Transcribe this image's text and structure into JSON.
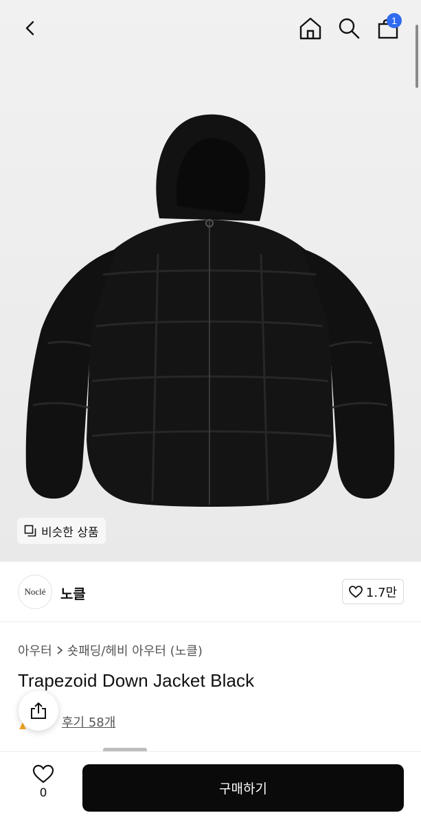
{
  "nav": {
    "back_icon": "chevron-left-icon",
    "home_icon": "home-icon",
    "search_icon": "search-icon",
    "cart_icon": "shopping-bag-icon",
    "cart_badge": "1",
    "badge_color": "#2f6bf0"
  },
  "hero": {
    "similar_label": "비슷한 상품",
    "similar_icon": "copy-icon"
  },
  "brand": {
    "logo_text": "Noclé",
    "name": "노클",
    "like_icon": "heart-icon",
    "like_count": "1.7만"
  },
  "breadcrumb": {
    "items": [
      "아우터",
      "숏패딩/헤비 아우터 (노클)"
    ]
  },
  "product": {
    "title": "Trapezoid Down Jacket Black",
    "reviews_label": "후기 58개"
  },
  "share_icon": "share-icon",
  "bottom": {
    "wish_icon": "heart-icon",
    "wish_count": "0",
    "buy_label": "구매하기"
  }
}
